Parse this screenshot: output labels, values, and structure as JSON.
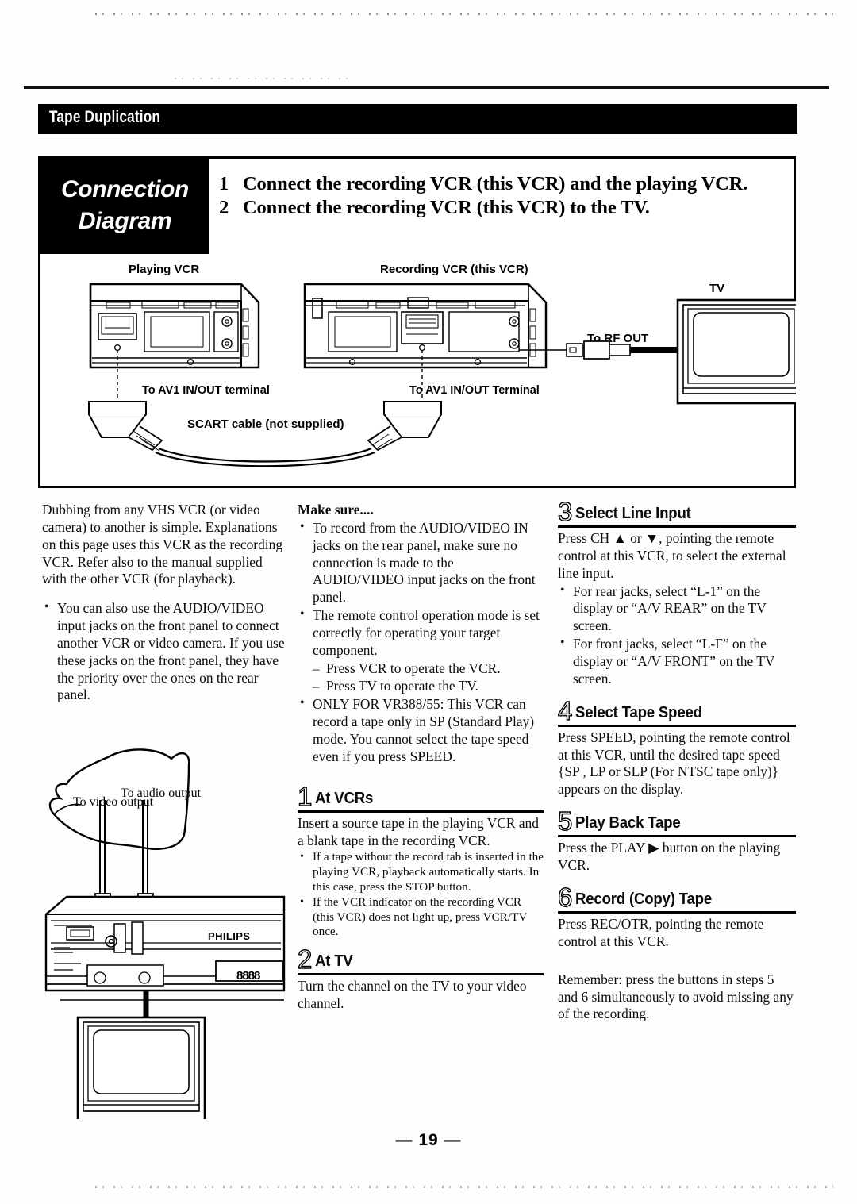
{
  "section": {
    "title": "Tape Duplication"
  },
  "diagram": {
    "heading_line1": "Connection",
    "heading_line2": "Diagram",
    "steps": [
      {
        "num": "1",
        "text": "Connect the recording VCR (this VCR) and the playing VCR."
      },
      {
        "num": "2",
        "text": "Connect the recording VCR (this VCR) to the TV."
      }
    ],
    "labels": {
      "playing_vcr": "Playing VCR",
      "recording_vcr": "Recording VCR (this VCR)",
      "tv": "TV",
      "to_av1_left": "To AV1 IN/OUT terminal",
      "to_av1_right": "To AV1 IN/OUT Terminal",
      "scart": "SCART cable (not supplied)",
      "to_rf_out": "To RF OUT"
    }
  },
  "left_column": {
    "intro": "Dubbing from any VHS VCR (or video camera) to another is simple. Explanations on this page uses this VCR as the recording VCR. Refer also to the manual supplied with the other VCR (for playback).",
    "bullets": [
      "You can also use the AUDIO/VIDEO input jacks on the front panel to connect another VCR or video camera. If you use these jacks on the front panel, they have the priority over the ones on the rear panel."
    ],
    "figure_labels": {
      "to_video_output": "To video output",
      "to_audio_output": "To audio output",
      "brand": "PHILIPS",
      "display": "8888"
    }
  },
  "middle_column": {
    "make_sure_heading": "Make sure....",
    "make_sure_bullets": [
      "To record from the AUDIO/VIDEO IN jacks on the rear panel, make sure no connection is made to the AUDIO/VIDEO input jacks on the front panel.",
      "The remote control operation mode is set correctly for operating your target component.",
      "ONLY FOR VR388/55: This VCR can record a tape only in SP (Standard Play) mode. You cannot select the tape speed even if you press SPEED."
    ],
    "dashes": [
      "Press VCR to operate the VCR.",
      "Press TV to operate the TV."
    ],
    "step1": {
      "num": "1",
      "title": "At VCRs",
      "body": "Insert a source tape in the playing VCR and a blank tape in the recording VCR.",
      "notes": [
        "If a tape without the record tab is inserted in the playing VCR, playback automatically starts. In this case, press the STOP button.",
        "If the VCR indicator on the recording VCR (this VCR) does not light up, press VCR/TV once."
      ]
    },
    "step2": {
      "num": "2",
      "title": "At TV",
      "body": "Turn the channel on the TV to your video channel."
    }
  },
  "right_column": {
    "step3": {
      "num": "3",
      "title": "Select Line Input",
      "body": "Press CH ▲ or ▼, pointing the remote control at this VCR, to select the external line input.",
      "bullets": [
        "For rear jacks, select “L-1” on the display or “A/V REAR” on the TV screen.",
        "For front jacks, select “L-F” on the display or “A/V FRONT” on the TV screen."
      ]
    },
    "step4": {
      "num": "4",
      "title": "Select Tape Speed",
      "body": "Press SPEED, pointing the remote control at this VCR, until the desired tape speed {SP , LP or SLP (For NTSC tape only)} appears on the display."
    },
    "step5": {
      "num": "5",
      "title": "Play Back Tape",
      "body": "Press the PLAY ▶ button on the playing VCR."
    },
    "step6": {
      "num": "6",
      "title": "Record (Copy) Tape",
      "body": "Press REC/OTR, pointing the remote control at this VCR."
    },
    "remember": "Remember: press the buttons in steps 5 and 6 simultaneously to avoid missing any of the recording."
  },
  "footer": {
    "page_number": "— 19 —"
  }
}
